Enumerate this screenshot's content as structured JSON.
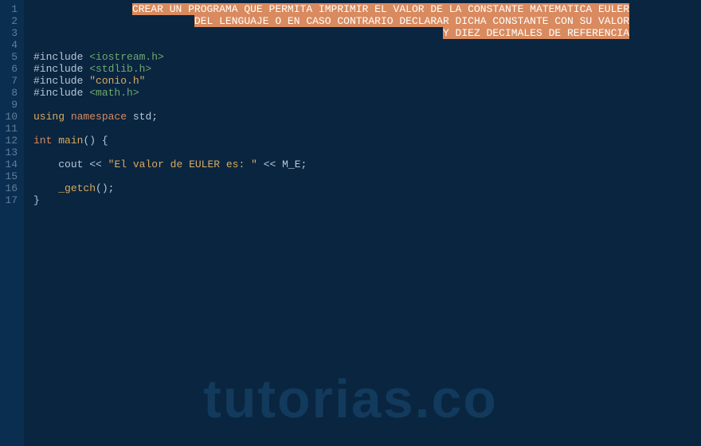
{
  "editor": {
    "lines": [
      {
        "n": 1,
        "type": "comment-right",
        "text": "CREAR UN PROGRAMA QUE PERMITA IMPRIMIR EL VALOR DE LA CONSTANTE MATEMATICA EULER"
      },
      {
        "n": 2,
        "type": "comment-right",
        "text": "DEL LENGUAJE O EN CASO CONTRARIO DECLARAR DICHA CONSTANTE CON SU VALOR"
      },
      {
        "n": 3,
        "type": "comment-right",
        "text": "Y DIEZ DECIMALES DE REFERENCIA"
      },
      {
        "n": 4,
        "type": "blank",
        "text": ""
      },
      {
        "n": 5,
        "type": "include-angle",
        "directive": "#include ",
        "target": "<iostream.h>"
      },
      {
        "n": 6,
        "type": "include-angle",
        "directive": "#include ",
        "target": "<stdlib.h>"
      },
      {
        "n": 7,
        "type": "include-quote",
        "directive": "#include ",
        "target": "\"conio.h\""
      },
      {
        "n": 8,
        "type": "include-angle",
        "directive": "#include ",
        "target": "<math.h>"
      },
      {
        "n": 9,
        "type": "blank",
        "text": ""
      },
      {
        "n": 10,
        "type": "using",
        "kw1": "using",
        "kw2": "namespace",
        "ident": "std",
        "semi": ";"
      },
      {
        "n": 11,
        "type": "blank",
        "text": ""
      },
      {
        "n": 12,
        "type": "main",
        "rettype": "int",
        "name": "main",
        "rest": "() {"
      },
      {
        "n": 13,
        "type": "blank",
        "text": ""
      },
      {
        "n": 14,
        "type": "cout",
        "indent": "    ",
        "kw": "cout",
        "op1": " << ",
        "str": "\"El valor de EULER es: \"",
        "op2": " << ",
        "ident": "M_E",
        "semi": ";"
      },
      {
        "n": 15,
        "type": "blank",
        "text": ""
      },
      {
        "n": 16,
        "type": "getch",
        "indent": "    ",
        "name": "_getch",
        "rest": "();",
        "semi": ""
      },
      {
        "n": 17,
        "type": "brace",
        "text": "}"
      }
    ]
  },
  "watermark": "tutorias.co"
}
